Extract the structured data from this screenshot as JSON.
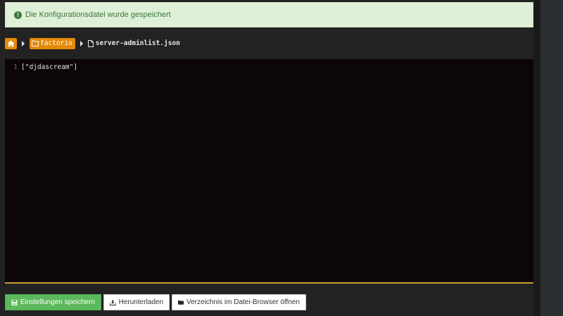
{
  "alert": {
    "message": "Die Konfigurationsdatei wurde gespeichert",
    "icon": "exclamation-circle-icon"
  },
  "breadcrumb": {
    "home_icon": "home-icon",
    "folder": "factorio",
    "file": "server-adminlist.json"
  },
  "editor": {
    "lines": [
      {
        "number": "1",
        "text": "[\"djdascream\"]"
      }
    ]
  },
  "actions": {
    "save_label": "Einstellungen speichern",
    "download_label": "Herunterladen",
    "browser_label": "Verzeichnis im Datei-Browser öffnen"
  },
  "colors": {
    "accent_orange": "#e5890a",
    "success_green": "#5cb85c",
    "alert_bg": "#dff0d8",
    "alert_text": "#3c763d",
    "editor_bg": "#0c0606",
    "editor_border": "#c9a227"
  }
}
